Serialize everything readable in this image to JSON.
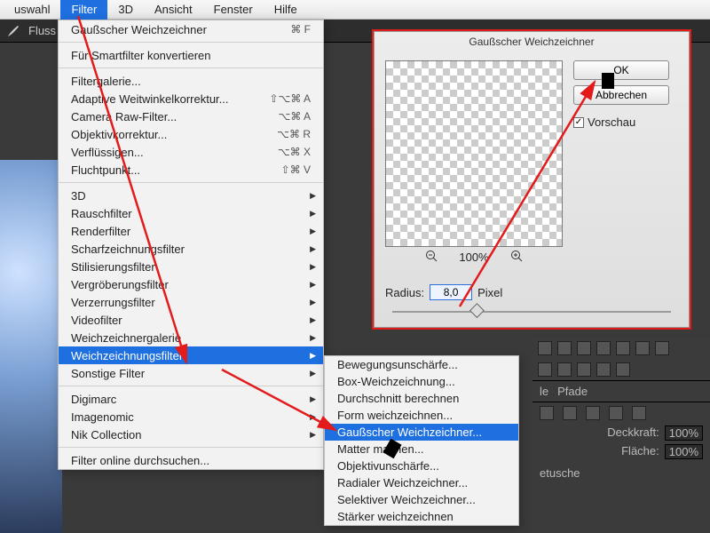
{
  "menubar": {
    "items": [
      "uswahl",
      "Filter",
      "3D",
      "Ansicht",
      "Fenster",
      "Hilfe"
    ],
    "selected_index": 1
  },
  "darkbar": {
    "label": "Fluss"
  },
  "menu": {
    "last_label": "Gaußscher Weichzeichner",
    "last_sc": "⌘ F",
    "smart": "Für Smartfilter konvertieren",
    "galerie": "Filtergalerie...",
    "weitwinkel": "Adaptive Weitwinkelkorrektur...",
    "weitwinkel_sc": "⇧⌥⌘ A",
    "cameraraw": "Camera Raw-Filter...",
    "cameraraw_sc": "⌥⌘ A",
    "objektiv": "Objektivkorrektur...",
    "objektiv_sc": "⌥⌘ R",
    "verfl": "Verflüssigen...",
    "verfl_sc": "⌥⌘ X",
    "flucht": "Fluchtpunkt...",
    "flucht_sc": "⇧⌘ V",
    "g3d": "3D",
    "rausch": "Rauschfilter",
    "render": "Renderfilter",
    "scharf": "Scharfzeichnungsfilter",
    "stil": "Stilisierungsfilter",
    "vergr": "Vergröberungsfilter",
    "verzerr": "Verzerrungsfilter",
    "video": "Videofilter",
    "weichgal": "Weichzeichnergalerie",
    "weich": "Weichzeichnungsfilter",
    "sonst": "Sonstige Filter",
    "digi": "Digimarc",
    "imgn": "Imagenomic",
    "nik": "Nik Collection",
    "online": "Filter online durchsuchen..."
  },
  "submenu": {
    "items": [
      "Bewegungsunschärfe...",
      "Box-Weichzeichnung...",
      "Durchschnitt berechnen",
      "Form weichzeichnen...",
      "Gaußscher Weichzeichner...",
      "Matter machen...",
      "Objektivunschärfe...",
      "Radialer Weichzeichner...",
      "Selektiver Weichzeichner...",
      "Stärker weichzeichnen"
    ],
    "selected_index": 4
  },
  "dialog": {
    "title": "Gaußscher Weichzeichner",
    "ok": "OK",
    "cancel": "Abbrechen",
    "preview_label": "Vorschau",
    "zoom_pct": "100%",
    "radius_label": "Radius:",
    "radius_value": "8,0",
    "radius_unit": "Pixel"
  },
  "rightpanel": {
    "tabs": {
      "a": "le",
      "b": "Pfade"
    },
    "opacity_label": "Deckkraft:",
    "opacity_val": "100%",
    "fill_label": "Fläche:",
    "fill_val": "100%",
    "layer": "etusche"
  }
}
